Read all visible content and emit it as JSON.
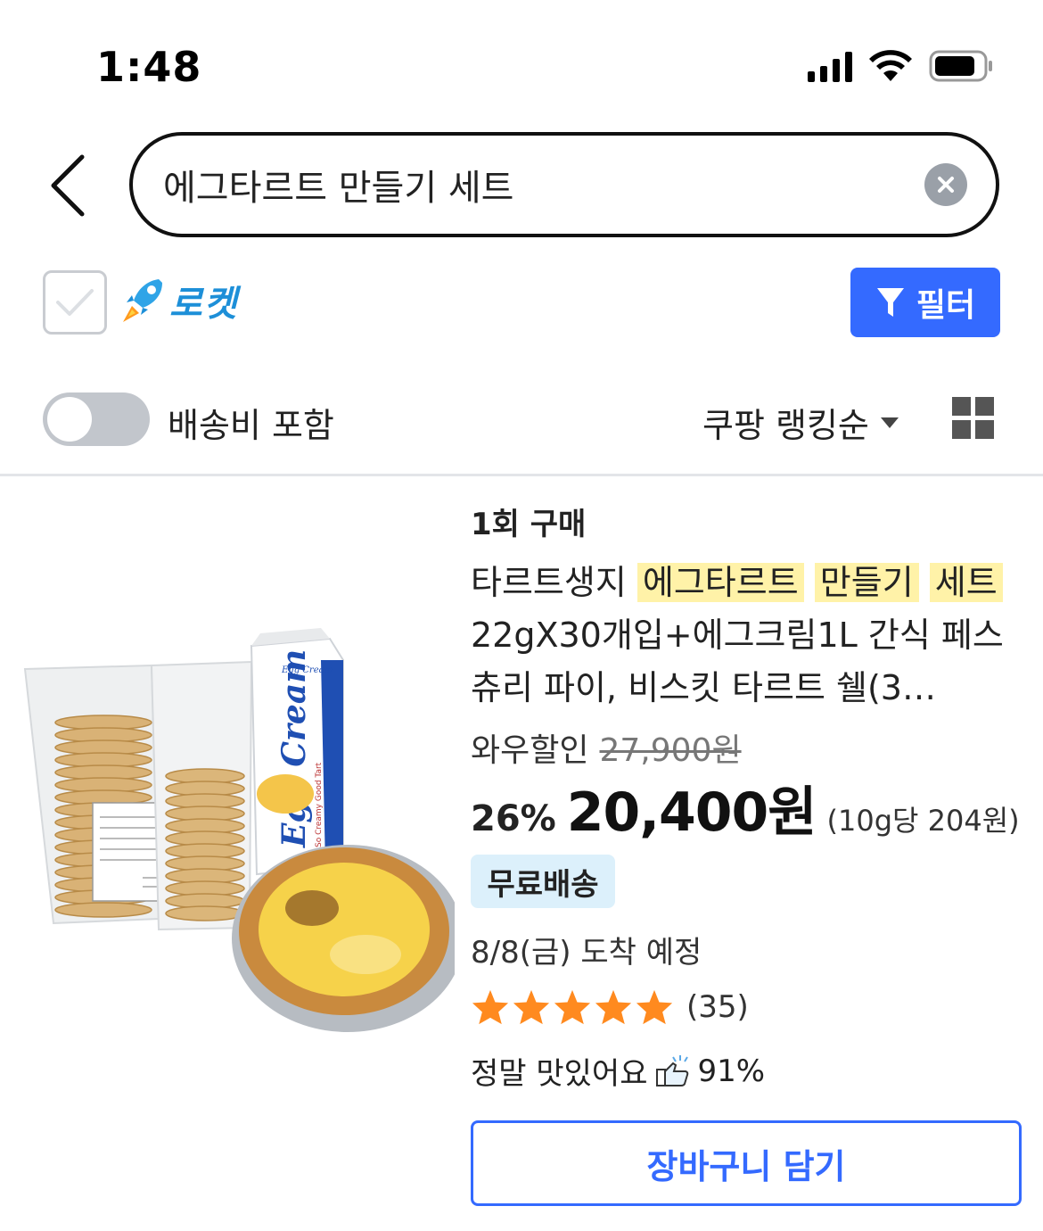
{
  "status_bar": {
    "time": "1:48",
    "battery_icon": "battery-icon",
    "wifi_icon": "wifi-icon",
    "signal_icon": "signal-icon"
  },
  "search": {
    "query": "에그타르트 만들기 세트",
    "back_icon": "chevron-left-icon",
    "clear_icon": "clear-icon"
  },
  "filters": {
    "rocket_checked": false,
    "rocket_label": "로켓",
    "filter_label": "필터",
    "shipping_toggle_label": "배송비 포함",
    "shipping_toggle_on": false,
    "sort_label": "쿠팡 랭킹순"
  },
  "product": {
    "purchase_type": "1회 구매",
    "title_prefix": "타르트생지 ",
    "title_hl1": "에그타르트",
    "title_hl2": "만들기",
    "title_hl3": "세트",
    "title_rest": "22gX30개입+에그크림1L 간식 페스츄리 파이, 비스킷 타르트 쉘(3…",
    "wow_label": "와우할인",
    "original_price": "27,900원",
    "discount": "26%",
    "price": "20,400원",
    "unit_price": "(10g당 204원)",
    "free_shipping": "무료배송",
    "arrival": "8/8(금) 도착 예정",
    "rating": 5,
    "review_count": "(35)",
    "taste_label": "정말 맛있어요",
    "taste_percent": "91%",
    "cart_button": "장바구니 담기",
    "image_texts": {
      "carton_brand": "Egg Cream",
      "carton_tagline": "So Creamy Good Tart"
    }
  },
  "colors": {
    "accent": "#346aff",
    "rocket": "#1d8fd8",
    "highlight": "#fff2a8",
    "star": "#ff8a1f",
    "badge_bg": "#dcf0fb"
  }
}
